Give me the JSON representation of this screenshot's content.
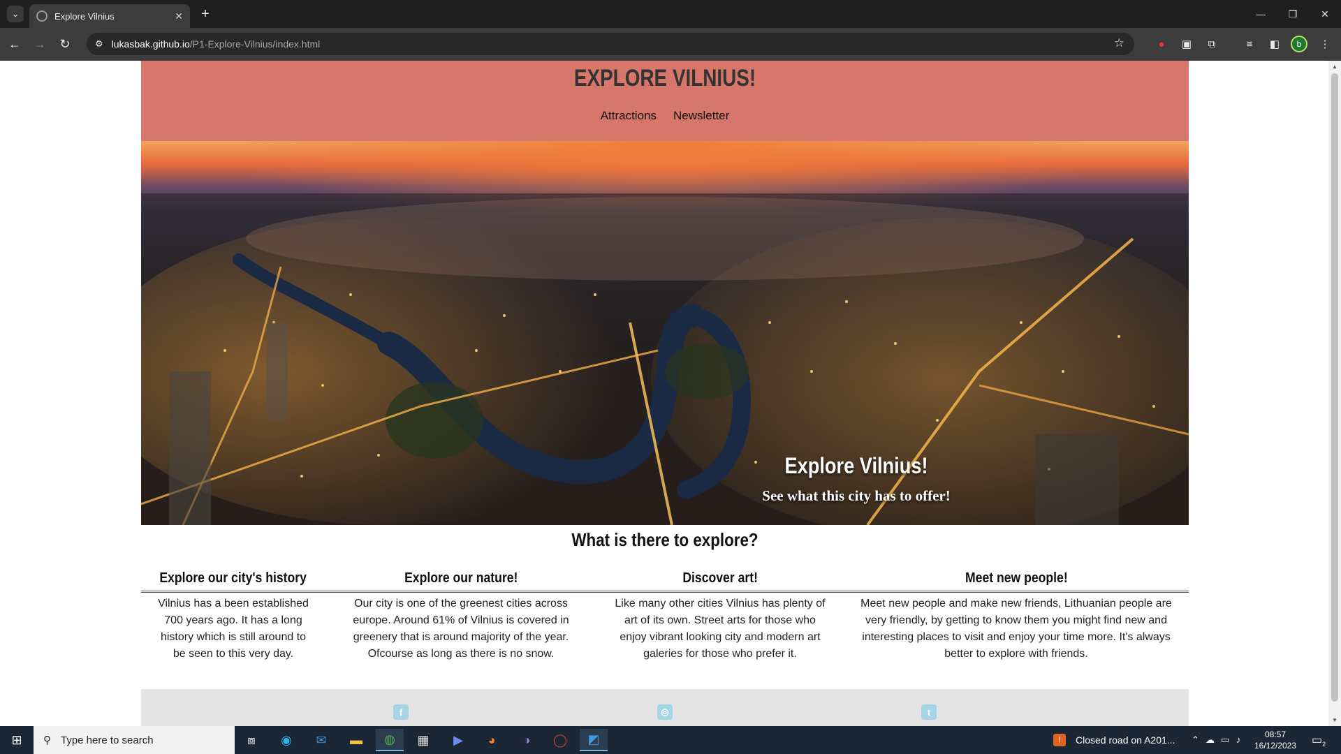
{
  "browser": {
    "tab_title": "Explore Vilnius",
    "tab_close": "✕",
    "new_tab": "+",
    "url_host": "lukasbak.github.io",
    "url_path": "/P1-Explore-Vilnius/index.html",
    "profile_initial": "b",
    "window_controls": [
      "—",
      "❐",
      "✕"
    ]
  },
  "site": {
    "title": "EXPLORE VILNIUS!",
    "nav": [
      "Attractions",
      "Newsletter"
    ],
    "hero": {
      "title": "Explore Vilnius!",
      "subtitle": "See what this city has to offer!"
    },
    "section_title": "What is there to explore?",
    "features": [
      {
        "title": "Explore our city's history",
        "text": "Vilnius has a been established 700 years ago. It has a long history which is still around to be seen to this very day."
      },
      {
        "title": "Explore our nature!",
        "text": "Our city is one of the greenest cities across europe. Around 61% of Vilnius is covered in greenery that is around majority of the year. Ofcourse as long as there is no snow."
      },
      {
        "title": "Discover art!",
        "text": "Like many other cities Vilnius has plenty of art of its own. Street arts for those who enjoy vibrant looking city and modern art galeries for those who prefer it."
      },
      {
        "title": "Meet new people!",
        "text": "Meet new people and make new friends, Lithuanian people are very friendly, by getting to know them you might find new and interesting places to visit and enjoy your time more. It's always better to explore with friends."
      }
    ],
    "social_icons": [
      "facebook-icon",
      "instagram-icon",
      "twitter-icon"
    ]
  },
  "taskbar": {
    "search_placeholder": "Type here to search",
    "notification": "Closed road on A201...",
    "time": "08:57",
    "date": "16/12/2023",
    "action_center_count": "2",
    "pinned_apps": [
      "task-view",
      "edge",
      "mail",
      "file-explorer",
      "chrome",
      "store",
      "media-player",
      "firefox",
      "discord",
      "opera",
      "photos"
    ]
  },
  "colors": {
    "header_bg": "#d7766a",
    "footer_bg": "#e4e4e4",
    "browser_dark": "#1f1f1f",
    "taskbar": "#1b2735"
  }
}
